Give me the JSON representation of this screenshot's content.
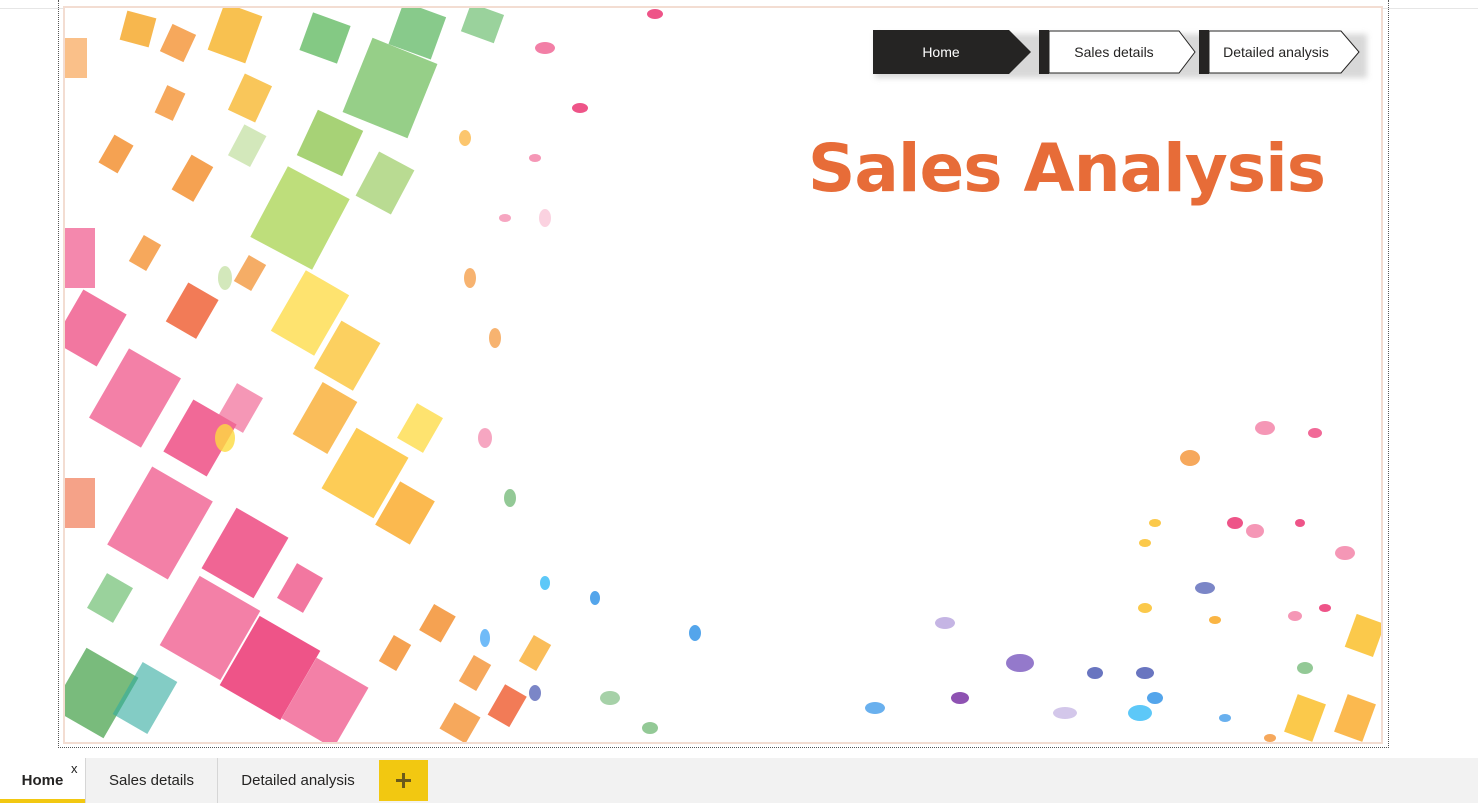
{
  "report": {
    "title": "Sales Analysis",
    "title_color": "#e76c38"
  },
  "navigation": {
    "buttons": [
      {
        "label": "Home",
        "state": "selected"
      },
      {
        "label": "Sales details",
        "state": "default"
      },
      {
        "label": "Detailed analysis",
        "state": "default"
      }
    ]
  },
  "tabs": {
    "items": [
      {
        "label": "Home",
        "active": true
      },
      {
        "label": "Sales details",
        "active": false
      },
      {
        "label": "Detailed analysis",
        "active": false
      }
    ],
    "close_label": "x",
    "add_icon": "plus-icon",
    "accent_color": "#f2c811"
  }
}
